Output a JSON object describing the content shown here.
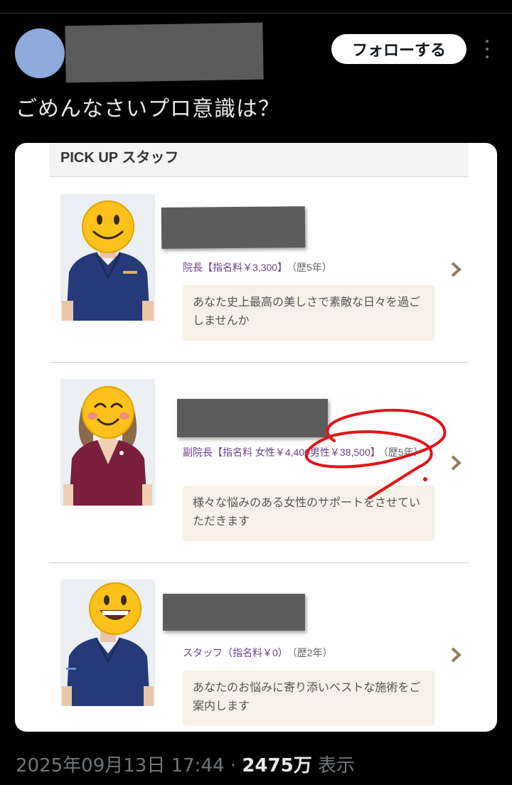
{
  "header": {
    "follow_label": "フォローする"
  },
  "tweet": {
    "text": "ごめんなさいプロ意識は？"
  },
  "media": {
    "section_title": "PICK UP スタッフ",
    "staff": [
      {
        "role": "院長【指名料￥3,300】",
        "years": "（歴5年）",
        "message": "あなた史上最高の美しさで素敵な日々を過ごしませんか"
      },
      {
        "role": "副院長【指名料 女性￥4,400男性￥38,500】",
        "years": "（歴5年）",
        "message": "様々な悩みのある女性のサポートをさせていただきます"
      },
      {
        "role": "スタッフ（指名料￥0）",
        "years": "（歴2年）",
        "message": "あなたのお悩みに寄り添いベストな施術をご案内します"
      }
    ]
  },
  "meta": {
    "date": "2025年09月13日 17:44",
    "separator": "·",
    "views": "2475万",
    "views_label": "表示"
  },
  "colors": {
    "background": "#000000",
    "role_text": "#6a3f8e",
    "message_bg": "#f5f1e6",
    "annotation_red": "#e0141b"
  }
}
